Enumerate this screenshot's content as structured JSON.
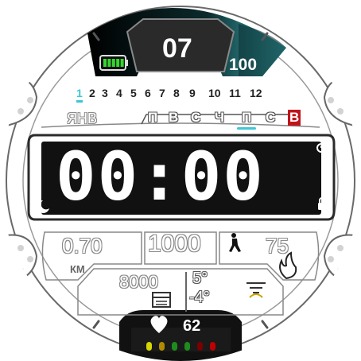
{
  "date": {
    "day": "07",
    "month": "ЯНВ"
  },
  "battery": {
    "percent": "100",
    "level": 1.0
  },
  "months": [
    "1",
    "2",
    "3",
    "4",
    "5",
    "6",
    "7",
    "8",
    "9",
    "10",
    "11",
    "12"
  ],
  "current_month_index": 0,
  "weekdays": [
    {
      "label": "П",
      "color": "#ffffff"
    },
    {
      "label": "В",
      "color": "#ffffff"
    },
    {
      "label": "С",
      "color": "#ffffff"
    },
    {
      "label": "Ч",
      "color": "#ffffff"
    },
    {
      "label": "П",
      "color": "#ffffff"
    },
    {
      "label": "С",
      "color": "#ffffff"
    },
    {
      "label": "В",
      "color": "#c0141b"
    }
  ],
  "current_weekday_index": 4,
  "time": {
    "hours": "00",
    "minutes": "00"
  },
  "stats": {
    "distance": "0.70",
    "distance_unit": "КМ",
    "steps": "1000",
    "calories": "75",
    "step_goal": "8000"
  },
  "weather": {
    "high": "5°",
    "low": "-4°"
  },
  "heart": {
    "bpm": "62",
    "zone_colors": [
      "#d6d600",
      "#b08a00",
      "#1e8b1e",
      "#1e8b1e",
      "#7a0000",
      "#c00000"
    ]
  },
  "colors": {
    "accent": "#3ec6d6",
    "sunday": "#c0141b",
    "dark": "#1a1a1a"
  }
}
